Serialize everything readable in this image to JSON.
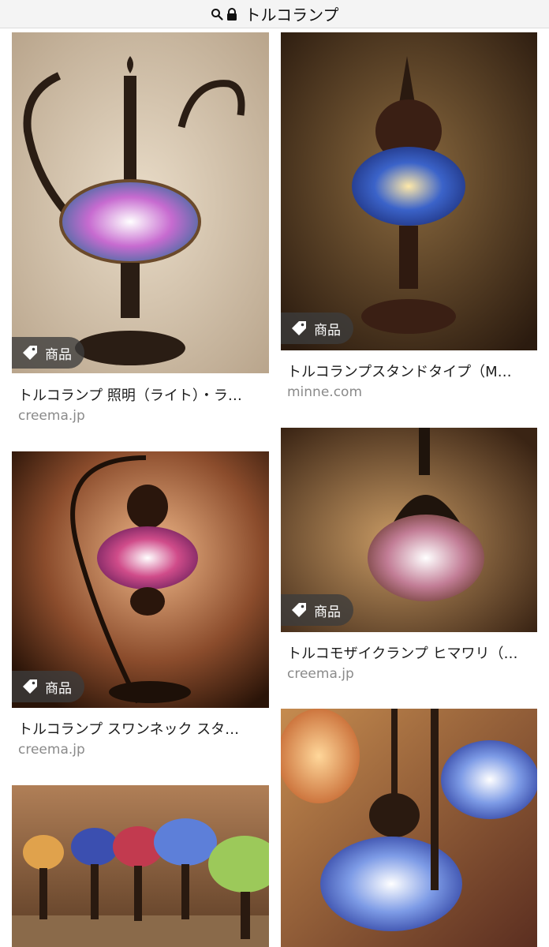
{
  "address_bar": {
    "query": "トルコランプ",
    "search_icon": "search-icon",
    "lock_icon": "lock-icon"
  },
  "results": [
    {
      "badge": "商品",
      "title": "トルコランプ 照明（ライト）・ラ…",
      "domain": "creema.jp"
    },
    {
      "badge": "商品",
      "title": "トルコランプスタンドタイプ（M…",
      "domain": "minne.com"
    },
    {
      "badge": "商品",
      "title": "トルコランプ スワンネック スタ…",
      "domain": "creema.jp"
    },
    {
      "badge": "商品",
      "title": "トルコモザイクランプ ヒマワリ（…",
      "domain": "creema.jp"
    }
  ],
  "colors": {
    "badge_bg": "#3c3c3c",
    "domain_text": "#8a8a8a",
    "title_text": "#1c1c1c"
  }
}
